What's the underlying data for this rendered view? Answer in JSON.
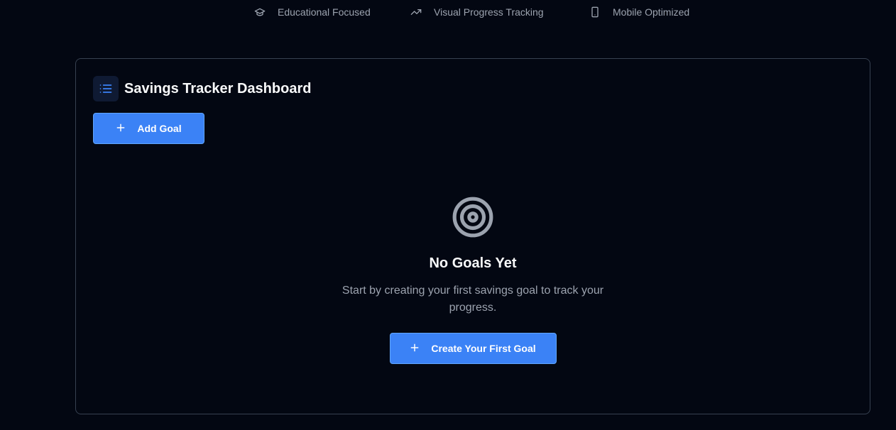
{
  "features": [
    {
      "icon": "graduation-cap-icon",
      "label": "Educational Focused"
    },
    {
      "icon": "trending-up-icon",
      "label": "Visual Progress Tracking"
    },
    {
      "icon": "smartphone-icon",
      "label": "Mobile Optimized"
    }
  ],
  "dashboard": {
    "title": "Savings Tracker Dashboard",
    "header_icon": "list-icon",
    "add_goal_label": "Add Goal"
  },
  "empty_state": {
    "icon": "target-icon",
    "title": "No Goals Yet",
    "description": "Start by creating your first savings goal to track your progress.",
    "create_label": "Create Your First Goal"
  },
  "colors": {
    "background": "#030712",
    "accent": "#3b82f6",
    "border": "#374151",
    "muted_text": "#9ca3af"
  }
}
